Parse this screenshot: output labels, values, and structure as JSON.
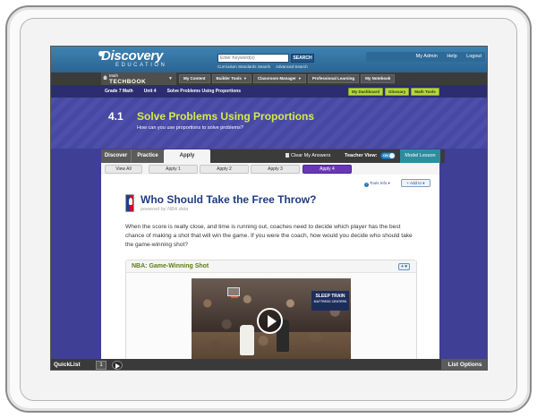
{
  "header": {
    "logo_main": "Discovery",
    "logo_sub": "EDUCATION",
    "search_placeholder": "Enter Keyword(s)",
    "search_button": "SEARCH",
    "search_links": [
      "Curriculum Standards Search",
      "Advanced Search"
    ],
    "util_links": [
      "My Admin",
      "Help",
      "Logout"
    ]
  },
  "nav": {
    "home_small": "Math",
    "home_brand": "TECHBOOK",
    "items": [
      "My Content",
      "Builder Tools",
      "Classroom Manager",
      "Professional Learning",
      "My Notebook"
    ],
    "dropdown_items": [
      "Builder Tools",
      "Classroom Manager"
    ]
  },
  "breadcrumb": {
    "items": [
      "Grade 7 Math",
      "Unit 4",
      "Solve Problems Using Proportions"
    ],
    "buttons": [
      "My Dashboard",
      "Glossary",
      "Math Tools"
    ]
  },
  "lesson": {
    "number": "4.1",
    "title": "Solve Problems Using Proportions",
    "question": "How can you use proportions to solve problems?"
  },
  "tabs": {
    "items": [
      "Discover",
      "Practice",
      "Apply"
    ],
    "active": "Apply",
    "clear_answers": "Clear My Answers",
    "teacher_view": "Teacher View:",
    "toggle_state": "ON",
    "model_lesson": "Model Lesson"
  },
  "subtabs": {
    "items": [
      "View All",
      "Apply 1",
      "Apply 2",
      "Apply 3",
      "Apply 4"
    ],
    "active": "Apply 4"
  },
  "content": {
    "tools_info": "Tools Info ▾",
    "add_to": "+ Add to ▾",
    "title": "Who Should Take the Free Throw?",
    "powered_by": "powered by NBA data",
    "body": "When the score is really close, and time is running out, coaches need to decide which player has the best chance of making a shot that will win the game. If you were the coach, how would you decide who should take the game-winning shot?",
    "card_title": "NBA: Game-Winning Shot",
    "card_add": "+ ▾",
    "video_sign": "SLEEP TRAIN",
    "video_sign_sub": "MATTRESS CENTERS"
  },
  "footer": {
    "quicklist": "QuickList",
    "count": "1",
    "list_options": "List Options"
  },
  "colors": {
    "header_blue": "#2a6493",
    "banner_purple": "#4e4fab",
    "title_green": "#d4ec48",
    "apply4_purple": "#6a36b8",
    "article_title_blue": "#1f3b86"
  }
}
